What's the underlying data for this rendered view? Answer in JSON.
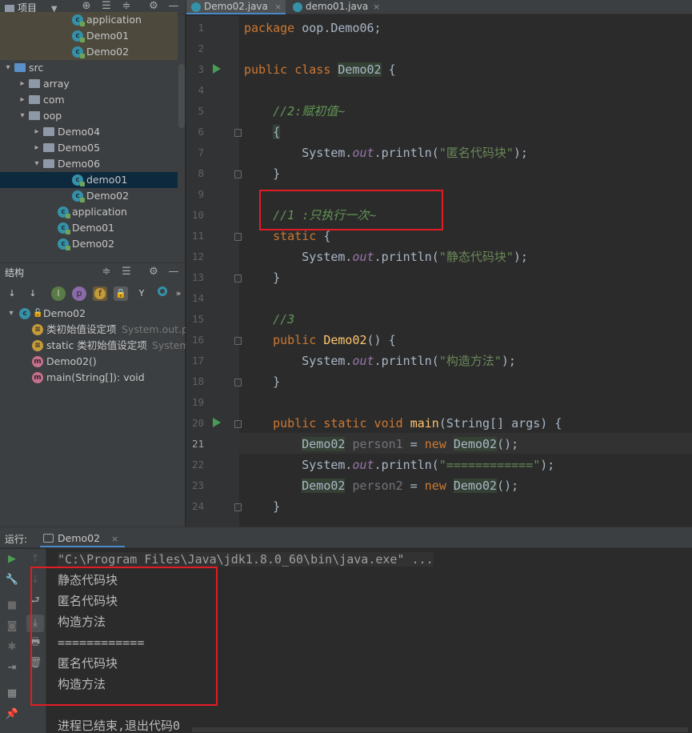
{
  "project_panel": {
    "title": "项目",
    "tree": [
      {
        "label": "application",
        "kind": "class",
        "indent": 5,
        "hl": true
      },
      {
        "label": "Demo01",
        "kind": "class",
        "indent": 5,
        "hl": true
      },
      {
        "label": "Demo02",
        "kind": "class",
        "indent": 5,
        "hl": true
      },
      {
        "label": "src",
        "kind": "src",
        "indent": 1,
        "arrow": "down"
      },
      {
        "label": "array",
        "kind": "folder",
        "indent": 2,
        "arrow": "right"
      },
      {
        "label": "com",
        "kind": "folder",
        "indent": 2,
        "arrow": "right"
      },
      {
        "label": "oop",
        "kind": "folder",
        "indent": 2,
        "arrow": "down"
      },
      {
        "label": "Demo04",
        "kind": "folder",
        "indent": 3,
        "arrow": "right"
      },
      {
        "label": "Demo05",
        "kind": "folder",
        "indent": 3,
        "arrow": "right"
      },
      {
        "label": "Demo06",
        "kind": "folder",
        "indent": 3,
        "arrow": "down"
      },
      {
        "label": "demo01",
        "kind": "class",
        "indent": 5,
        "sel": true
      },
      {
        "label": "Demo02",
        "kind": "class",
        "indent": 5
      },
      {
        "label": "application",
        "kind": "class",
        "indent": 4
      },
      {
        "label": "Demo01",
        "kind": "class",
        "indent": 4
      },
      {
        "label": "Demo02",
        "kind": "class",
        "indent": 4
      }
    ]
  },
  "structure_panel": {
    "title": "结构",
    "items": [
      {
        "label": "Demo02",
        "detail": "",
        "kind": "class",
        "indent": 1,
        "arrow": "down"
      },
      {
        "label": "类初始值设定项",
        "detail": "System.out.pri",
        "kind": "init",
        "indent": 2
      },
      {
        "label": "static 类初始值设定项",
        "detail": "System.o",
        "kind": "init",
        "indent": 2
      },
      {
        "label": "Demo02()",
        "detail": "",
        "kind": "method",
        "indent": 2
      },
      {
        "label": "main(String[]): void",
        "detail": "",
        "kind": "method",
        "indent": 2
      }
    ]
  },
  "editor": {
    "tabs": [
      {
        "label": "Demo02.java",
        "active": true
      },
      {
        "label": "demo01.java",
        "active": false
      }
    ],
    "current_line": 21,
    "lines": [
      {
        "n": "1",
        "html": "<span class='kw'>package </span>oop.Demo06;"
      },
      {
        "n": "2",
        "html": ""
      },
      {
        "n": "3",
        "html": "<span class='kw'>public class </span><span class='cls-ref'>Demo02</span> {",
        "run": true
      },
      {
        "n": "4",
        "html": ""
      },
      {
        "n": "5",
        "html": "    <span class='cmt'>//2:赋初值~</span>"
      },
      {
        "n": "6",
        "html": "    <span class='cls-ref'>{</span>",
        "fold": true
      },
      {
        "n": "7",
        "html": "        System.<span class='fld'>out</span>.println(<span class='str'>\"匿名代码块\"</span>);"
      },
      {
        "n": "8",
        "html": "    }",
        "fold": true
      },
      {
        "n": "9",
        "html": ""
      },
      {
        "n": "10",
        "html": "    <span class='cmt'>//1 :只执行一次~</span>"
      },
      {
        "n": "11",
        "html": "    <span class='kw'>static </span>{",
        "fold": true
      },
      {
        "n": "12",
        "html": "        System.<span class='fld'>out</span>.println(<span class='str'>\"静态代码块\"</span>);"
      },
      {
        "n": "13",
        "html": "    }",
        "fold": true
      },
      {
        "n": "14",
        "html": ""
      },
      {
        "n": "15",
        "html": "    <span class='cmt'>//3</span>"
      },
      {
        "n": "16",
        "html": "    <span class='kw'>public </span><span class='fn'>Demo02</span>() {",
        "fold": true
      },
      {
        "n": "17",
        "html": "        System.<span class='fld'>out</span>.println(<span class='str'>\"构造方法\"</span>);"
      },
      {
        "n": "18",
        "html": "    }",
        "fold": true
      },
      {
        "n": "19",
        "html": ""
      },
      {
        "n": "20",
        "html": "    <span class='kw'>public static void </span><span class='fn'>main</span>(String[] args) {",
        "run": true,
        "fold": true
      },
      {
        "n": "21",
        "html": "        <span class='cls-ref'>Demo02</span> <span class='unused'>person1</span> = <span class='kw'>new </span><span class='cls-ref'>Demo02</span>();"
      },
      {
        "n": "22",
        "html": "        System.<span class='fld'>out</span>.println(<span class='str'>\"============\"</span>);"
      },
      {
        "n": "23",
        "html": "        <span class='cls-ref'>Demo02</span> <span class='unused'>person2</span> = <span class='kw'>new </span><span class='cls-ref'>Demo02</span>();"
      },
      {
        "n": "24",
        "html": "    }",
        "fold": true
      }
    ]
  },
  "run_panel": {
    "title": "运行:",
    "tab_label": "Demo02",
    "output": [
      {
        "text": "\"C:\\Program Files\\Java\\jdk1.8.0_60\\bin\\java.exe\" ...",
        "grey": true
      },
      {
        "text": "静态代码块"
      },
      {
        "text": "匿名代码块"
      },
      {
        "text": "构造方法"
      },
      {
        "text": "============"
      },
      {
        "text": "匿名代码块"
      },
      {
        "text": "构造方法"
      },
      {
        "text": ""
      },
      {
        "text": "进程已结束,退出代码0"
      }
    ]
  },
  "colors": {
    "accent": "#4a88c7",
    "annotation_box": "#e21c24",
    "run_green": "#499c54"
  }
}
